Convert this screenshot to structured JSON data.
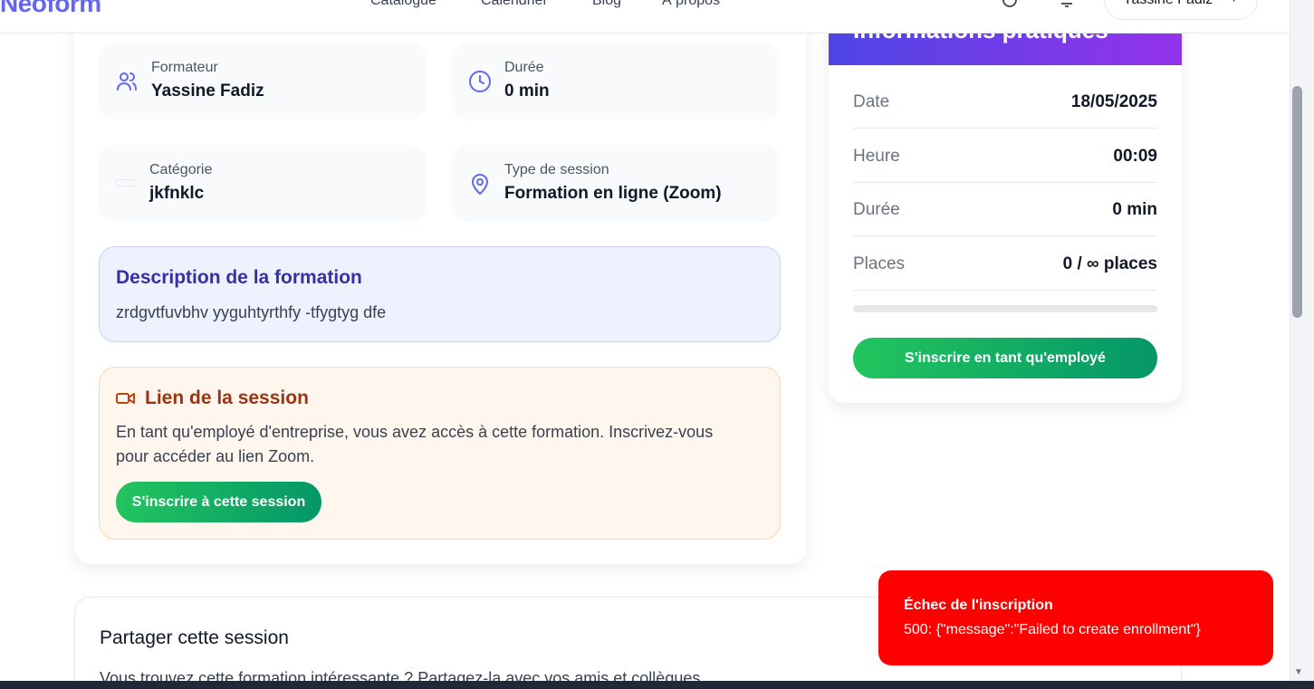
{
  "navbar": {
    "logo": "Neoform",
    "links": [
      "Catalogue",
      "Calendrier",
      "Blog",
      "À propos"
    ],
    "user_name": "Yassine Fadiz",
    "icons": [
      "theme-icon",
      "bell-icon"
    ]
  },
  "session": {
    "trainer_label": "Formateur",
    "trainer_value": "Yassine Fadiz",
    "duration_label": "Durée",
    "duration_value": "0 min",
    "category_label": "Catégorie",
    "category_value": "jkfnklc",
    "type_label": "Type de session",
    "type_value": "Formation en ligne (Zoom)",
    "description_title": "Description de la formation",
    "description_text": "zrdgvtfuvbhv yyguhtyrthfy -tfygtyg dfe",
    "link_title": "Lien de la session",
    "link_text": "En tant qu'employé d'entreprise, vous avez accès à cette formation. Inscrivez-vous pour accéder au lien Zoom.",
    "link_button": "S'inscrire à cette session"
  },
  "sidebar": {
    "title": "Informations pratiques",
    "rows": [
      {
        "key": "Date",
        "value": "18/05/2025"
      },
      {
        "key": "Heure",
        "value": "00:09"
      },
      {
        "key": "Durée",
        "value": "0 min"
      },
      {
        "key": "Places",
        "value": "0 / ∞ places"
      }
    ],
    "progress_fraction": 0,
    "button": "S'inscrire en tant qu'employé"
  },
  "share": {
    "title": "Partager cette session",
    "text": "Vous trouvez cette formation intéressante ? Partagez-la avec vos amis et collègues."
  },
  "toast": {
    "title": "Échec de l'inscription",
    "message": "500: {\"message\":\"Failed to create enrollment\"}",
    "color": "#ff0000"
  },
  "colors": {
    "accent": "#6366f1",
    "success_start": "#22c55e",
    "success_end": "#059669"
  }
}
